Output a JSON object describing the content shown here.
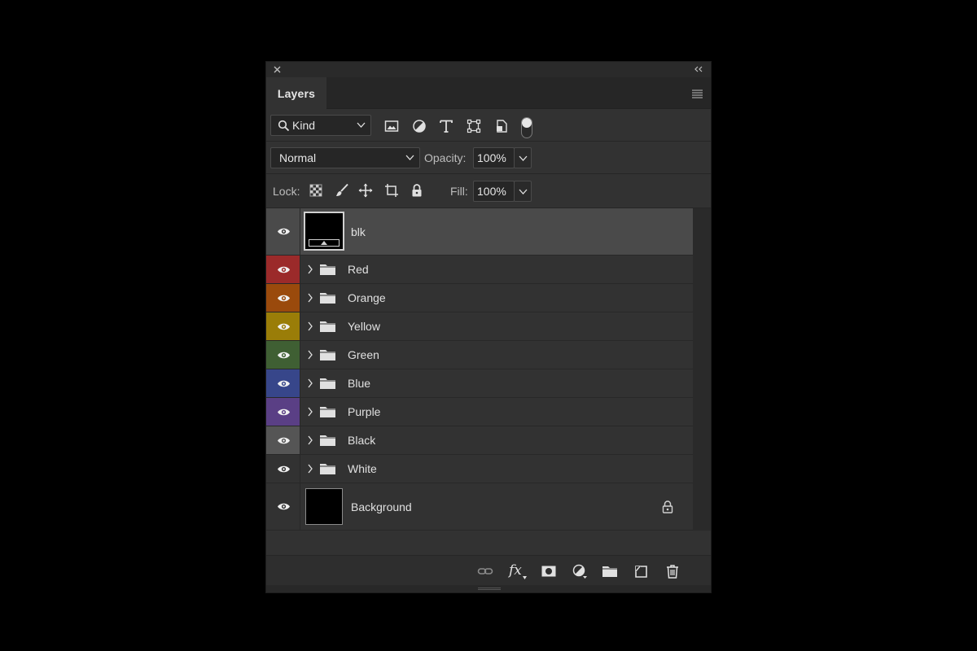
{
  "panel": {
    "tab_label": "Layers"
  },
  "filter": {
    "kind_label": "Kind",
    "icons": [
      "image-filter-icon",
      "adjustment-filter-icon",
      "type-filter-icon",
      "shape-filter-icon",
      "smart-object-filter-icon",
      "filter-toggle"
    ]
  },
  "blend": {
    "mode": "Normal",
    "opacity_label": "Opacity:",
    "opacity_value": "100%"
  },
  "lock": {
    "lock_label": "Lock:",
    "fill_label": "Fill:",
    "fill_value": "100%",
    "icons": [
      "lock-transparent-icon",
      "lock-image-icon",
      "lock-position-icon",
      "lock-artboard-icon",
      "lock-all-icon"
    ]
  },
  "layers": [
    {
      "name": "blk",
      "type": "smart-object",
      "selected": true
    },
    {
      "name": "Red",
      "type": "group",
      "color": "#9b2a2a"
    },
    {
      "name": "Orange",
      "type": "group",
      "color": "#9a4a0c"
    },
    {
      "name": "Yellow",
      "type": "group",
      "color": "#9a7d08"
    },
    {
      "name": "Green",
      "type": "group",
      "color": "#3f5f33"
    },
    {
      "name": "Blue",
      "type": "group",
      "color": "#37468a"
    },
    {
      "name": "Purple",
      "type": "group",
      "color": "#5a3f85"
    },
    {
      "name": "Black",
      "type": "group",
      "color": "#555555"
    },
    {
      "name": "White",
      "type": "group",
      "color": "#3a3a3a"
    },
    {
      "name": "Background",
      "type": "background",
      "locked": true
    }
  ],
  "bottom_icons": [
    "link-layers-icon",
    "fx-icon",
    "layer-mask-icon",
    "adjustment-layer-icon",
    "new-group-icon",
    "new-layer-icon",
    "delete-layer-icon"
  ],
  "bottom_fx_label": "fx"
}
